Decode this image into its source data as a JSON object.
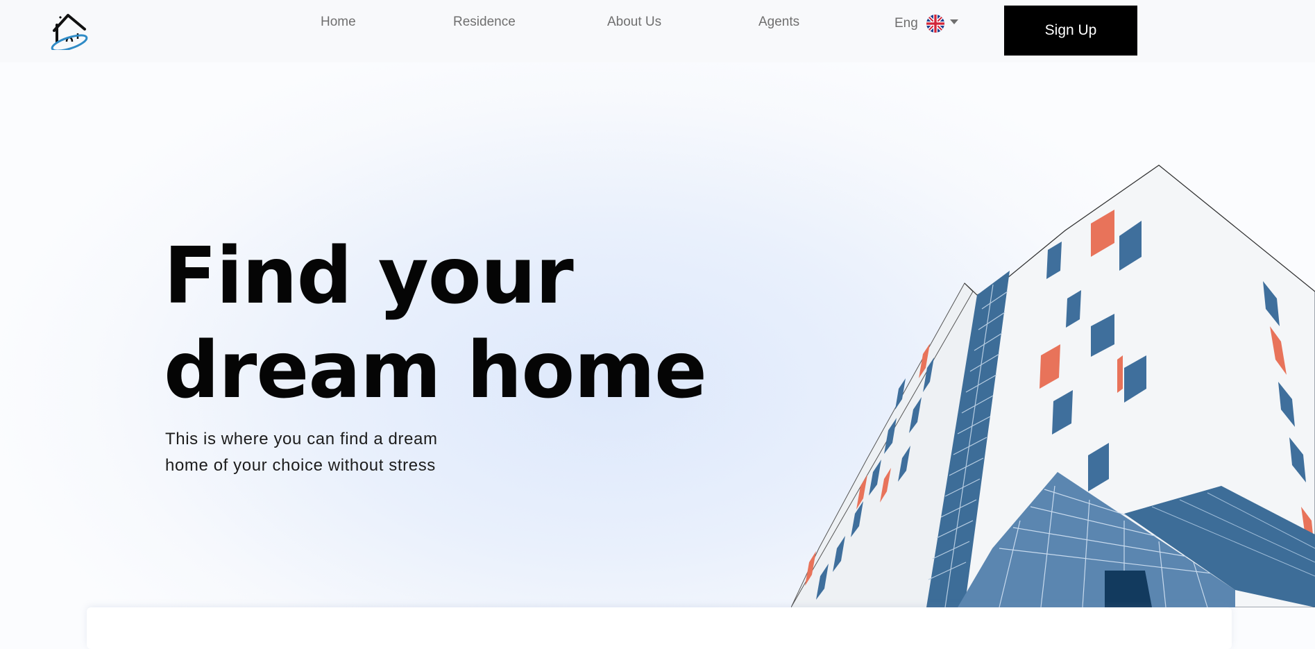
{
  "nav": {
    "links": [
      {
        "label": "Home"
      },
      {
        "label": "Residence"
      },
      {
        "label": "About Us"
      },
      {
        "label": "Agents"
      }
    ],
    "language": {
      "label": "Eng",
      "flag_icon": "uk-flag-icon"
    },
    "signup_label": "Sign Up"
  },
  "hero": {
    "title_line1": "Find your",
    "title_line2": "dream home",
    "subtitle": "This is where you can find a dream home of your choice without stress"
  },
  "colors": {
    "accent": "#000000",
    "nav_text": "#6f6f6f",
    "building_blue": "#3f6f9c",
    "building_orange": "#e8735a"
  }
}
